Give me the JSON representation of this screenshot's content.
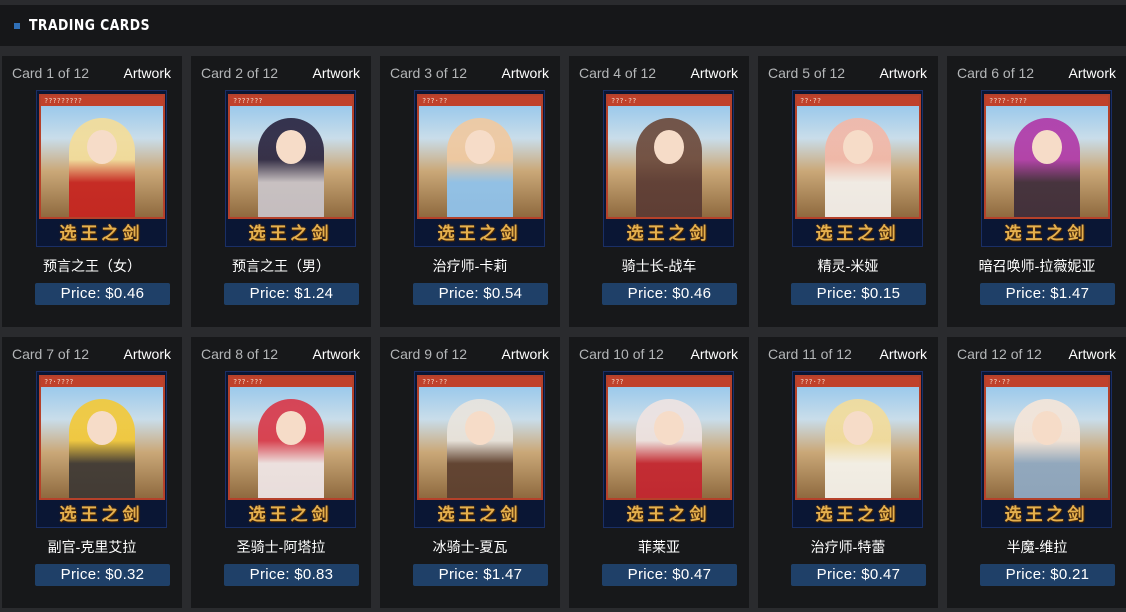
{
  "section": {
    "title": "TRADING CARDS"
  },
  "cards": [
    {
      "count": "Card 1 of 12",
      "kind": "Artwork",
      "label": "?????????",
      "name": "预言之王（女）",
      "price": "Price: $0.46",
      "logo": "选王之剑",
      "hair": "#f3dd9a",
      "body": "#c7231f"
    },
    {
      "count": "Card 2 of 12",
      "kind": "Artwork",
      "label": "???????",
      "name": "预言之王（男）",
      "price": "Price: $1.24",
      "logo": "选王之剑",
      "hair": "#2a2540",
      "body": "#c9c4c9"
    },
    {
      "count": "Card 3 of 12",
      "kind": "Artwork",
      "label": "???·??",
      "name": "治疗师-卡莉",
      "price": "Price: $0.54",
      "logo": "选王之剑",
      "hair": "#f0c9a0",
      "body": "#8fc4ef"
    },
    {
      "count": "Card 4 of 12",
      "kind": "Artwork",
      "label": "???·??",
      "name": "骑士长-战车",
      "price": "Price: $0.46",
      "logo": "选王之剑",
      "hair": "#6c4a3c",
      "body": "#5a3a33"
    },
    {
      "count": "Card 5 of 12",
      "kind": "Artwork",
      "label": "??·??",
      "name": "精灵-米娅",
      "price": "Price: $0.15",
      "logo": "选王之剑",
      "hair": "#f2b8a8",
      "body": "#f5f2ee"
    },
    {
      "count": "Card 6 of 12",
      "kind": "Artwork",
      "label": "????·????",
      "name": "暗召唤师-拉薇妮亚",
      "price": "Price: $1.47",
      "logo": "选王之剑",
      "hair": "#b03aa8",
      "body": "#3d2c3a"
    },
    {
      "count": "Card 7 of 12",
      "kind": "Artwork",
      "label": "??·????",
      "name": "副官-克里艾拉",
      "price": "Price: $0.32",
      "logo": "选王之剑",
      "hair": "#f2c93a",
      "body": "#3c3733"
    },
    {
      "count": "Card 8 of 12",
      "kind": "Artwork",
      "label": "???·???",
      "name": "圣骑士-阿塔拉",
      "price": "Price: $0.83",
      "logo": "选王之剑",
      "hair": "#d8394a",
      "body": "#f0e7e8"
    },
    {
      "count": "Card 9 of 12",
      "kind": "Artwork",
      "label": "???·??",
      "name": "冰骑士-夏瓦",
      "price": "Price: $1.47",
      "logo": "选王之剑",
      "hair": "#e9e4dd",
      "body": "#5b3e2e"
    },
    {
      "count": "Card 10 of 12",
      "kind": "Artwork",
      "label": "???",
      "name": "菲莱亚",
      "price": "Price: $0.47",
      "logo": "选王之剑",
      "hair": "#eee3e1",
      "body": "#c4242f"
    },
    {
      "count": "Card 11 of 12",
      "kind": "Artwork",
      "label": "???·??",
      "name": "治疗师-特蕾",
      "price": "Price: $0.47",
      "logo": "选王之剑",
      "hair": "#f2dc9c",
      "body": "#f7f5ee"
    },
    {
      "count": "Card 12 of 12",
      "kind": "Artwork",
      "label": "??·??",
      "name": "半魔-维拉",
      "price": "Price: $0.21",
      "logo": "选王之剑",
      "hair": "#f4e5d9",
      "body": "#8ea9c4"
    }
  ]
}
